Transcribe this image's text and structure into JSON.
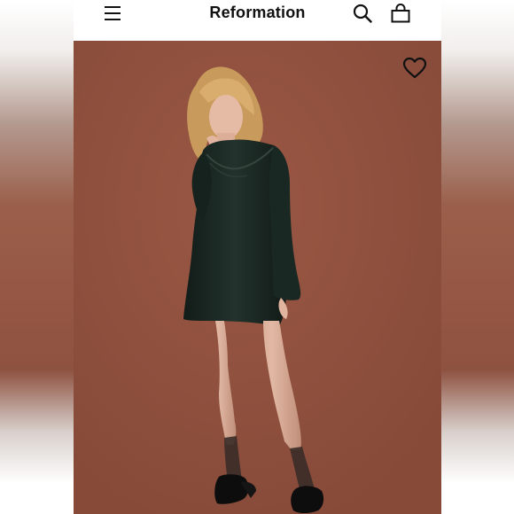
{
  "app": {
    "brand": "Reformation"
  },
  "header": {
    "menu_icon": "hamburger-menu-icon",
    "search_icon": "search-icon",
    "bag_icon": "shopping-bag-icon"
  },
  "product": {
    "image_subject": "model-in-black-satin-mini-dress",
    "favorite_icon": "heart-outline-icon"
  },
  "colors": {
    "background_brown": "#92523f",
    "dress": "#1b2823",
    "text": "#111111",
    "header_bg": "#ffffff"
  }
}
